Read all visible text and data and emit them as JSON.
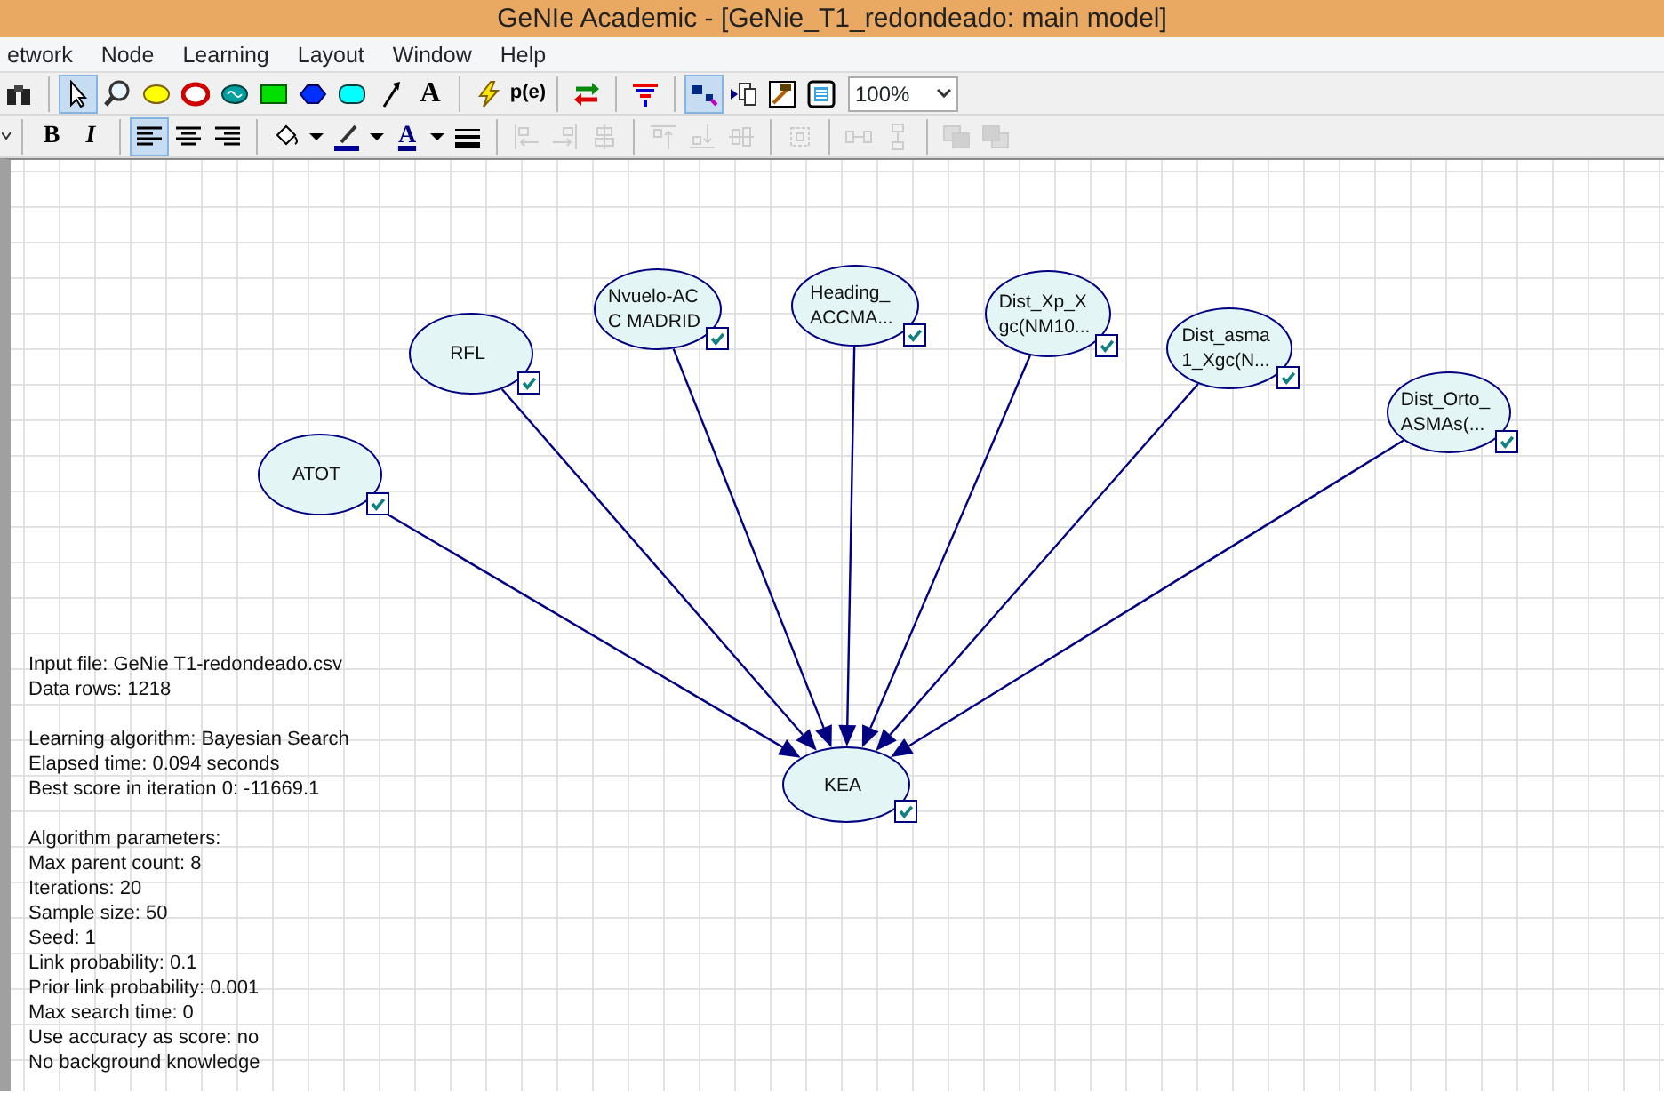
{
  "window": {
    "title": "GeNIe Academic - [GeNie_T1_redondeado: main model]"
  },
  "menu": [
    {
      "label": "etwork"
    },
    {
      "label": "Node"
    },
    {
      "label": "Learning"
    },
    {
      "label": "Layout"
    },
    {
      "label": "Window"
    },
    {
      "label": "Help"
    }
  ],
  "toolbar": [
    {
      "kind": "binoculars",
      "selected": false
    },
    {
      "kind": "separator"
    },
    {
      "kind": "pointer",
      "selected": true
    },
    {
      "kind": "magnifier",
      "selected": false
    },
    {
      "kind": "oval-yellow",
      "selected": false
    },
    {
      "kind": "oval-ring",
      "selected": false
    },
    {
      "kind": "oval-wave",
      "selected": false
    },
    {
      "kind": "rect-green",
      "selected": false
    },
    {
      "kind": "hexagon",
      "selected": false
    },
    {
      "kind": "rounded-rect",
      "selected": false
    },
    {
      "kind": "arc-tool",
      "selected": false
    },
    {
      "kind": "text-tool",
      "label": "A",
      "selected": false
    },
    {
      "kind": "separator"
    },
    {
      "kind": "lightning",
      "selected": false
    },
    {
      "kind": "text-tool-small",
      "label": "p(e)",
      "selected": false
    },
    {
      "kind": "separator"
    },
    {
      "kind": "swap",
      "selected": false
    },
    {
      "kind": "separator"
    },
    {
      "kind": "funnel",
      "selected": false
    },
    {
      "kind": "separator"
    },
    {
      "kind": "graph-view",
      "selected": true
    },
    {
      "kind": "copy-view",
      "selected": false
    },
    {
      "kind": "picture",
      "selected": false
    },
    {
      "kind": "list-view",
      "selected": false
    }
  ],
  "zoom": {
    "value": "100%"
  },
  "format_toolbar": [
    {
      "kind": "dropdown-edge",
      "selected": false,
      "disabled": false
    },
    {
      "kind": "separator"
    },
    {
      "kind": "bold",
      "label": "B",
      "selected": false,
      "disabled": false
    },
    {
      "kind": "italic",
      "label": "I",
      "selected": false,
      "disabled": false
    },
    {
      "kind": "separator"
    },
    {
      "kind": "align-left",
      "selected": true,
      "disabled": false
    },
    {
      "kind": "align-center",
      "selected": false,
      "disabled": false
    },
    {
      "kind": "align-right",
      "selected": false,
      "disabled": false
    },
    {
      "kind": "separator"
    },
    {
      "kind": "bucket",
      "selected": false,
      "disabled": false
    },
    {
      "kind": "caret",
      "selected": false,
      "disabled": false
    },
    {
      "kind": "pen",
      "selected": false,
      "disabled": false
    },
    {
      "kind": "caret",
      "selected": false,
      "disabled": false
    },
    {
      "kind": "font-color",
      "label": "A",
      "selected": false,
      "disabled": false
    },
    {
      "kind": "caret",
      "selected": false,
      "disabled": false
    },
    {
      "kind": "line-width",
      "selected": false,
      "disabled": false
    },
    {
      "kind": "separator"
    },
    {
      "kind": "align-edges-left",
      "selected": false,
      "disabled": true
    },
    {
      "kind": "align-edges-right",
      "selected": false,
      "disabled": true
    },
    {
      "kind": "align-centers",
      "selected": false,
      "disabled": true
    },
    {
      "kind": "separator"
    },
    {
      "kind": "align-tops",
      "selected": false,
      "disabled": true
    },
    {
      "kind": "align-bottoms",
      "selected": false,
      "disabled": true
    },
    {
      "kind": "align-middles",
      "selected": false,
      "disabled": true
    },
    {
      "kind": "separator"
    },
    {
      "kind": "same-size",
      "selected": false,
      "disabled": true
    },
    {
      "kind": "separator"
    },
    {
      "kind": "space-horizontal",
      "selected": false,
      "disabled": true
    },
    {
      "kind": "space-vertical",
      "selected": false,
      "disabled": true
    },
    {
      "kind": "separator"
    },
    {
      "kind": "front",
      "selected": false,
      "disabled": true
    },
    {
      "kind": "back",
      "selected": false,
      "disabled": true
    }
  ],
  "nodes": [
    {
      "kind": "parent",
      "lines": [
        "ATOT"
      ]
    },
    {
      "kind": "parent",
      "lines": [
        "RFL"
      ]
    },
    {
      "kind": "parent",
      "lines": [
        "Nvuelo-AC",
        "C MADRID"
      ]
    },
    {
      "kind": "parent",
      "lines": [
        "Heading_",
        "ACCMA..."
      ]
    },
    {
      "kind": "parent",
      "lines": [
        "Dist_Xp_X",
        "gc(NM10..."
      ]
    },
    {
      "kind": "parent",
      "lines": [
        "Dist_asma",
        "1_Xgc(N..."
      ]
    },
    {
      "kind": "parent",
      "lines": [
        "Dist_Orto_",
        "ASMAs(..."
      ]
    },
    {
      "kind": "target",
      "lines": [
        "KEA"
      ]
    }
  ],
  "log": [
    [
      "Input file: GeNie T1-redondeado.csv",
      "Data rows: 1218"
    ],
    [
      "Learning algorithm: Bayesian Search",
      "Elapsed time: 0.094 seconds",
      "Best score in iteration 0: -11669.1"
    ],
    [
      "Algorithm parameters:",
      "Max parent count: 8",
      "Iterations: 20",
      "Sample size: 50",
      "Seed: 1",
      "Link probability: 0.1",
      "Prior link probability: 0.001",
      "Max search time: 0",
      "Use accuracy as score: no",
      "No background knowledge"
    ]
  ]
}
